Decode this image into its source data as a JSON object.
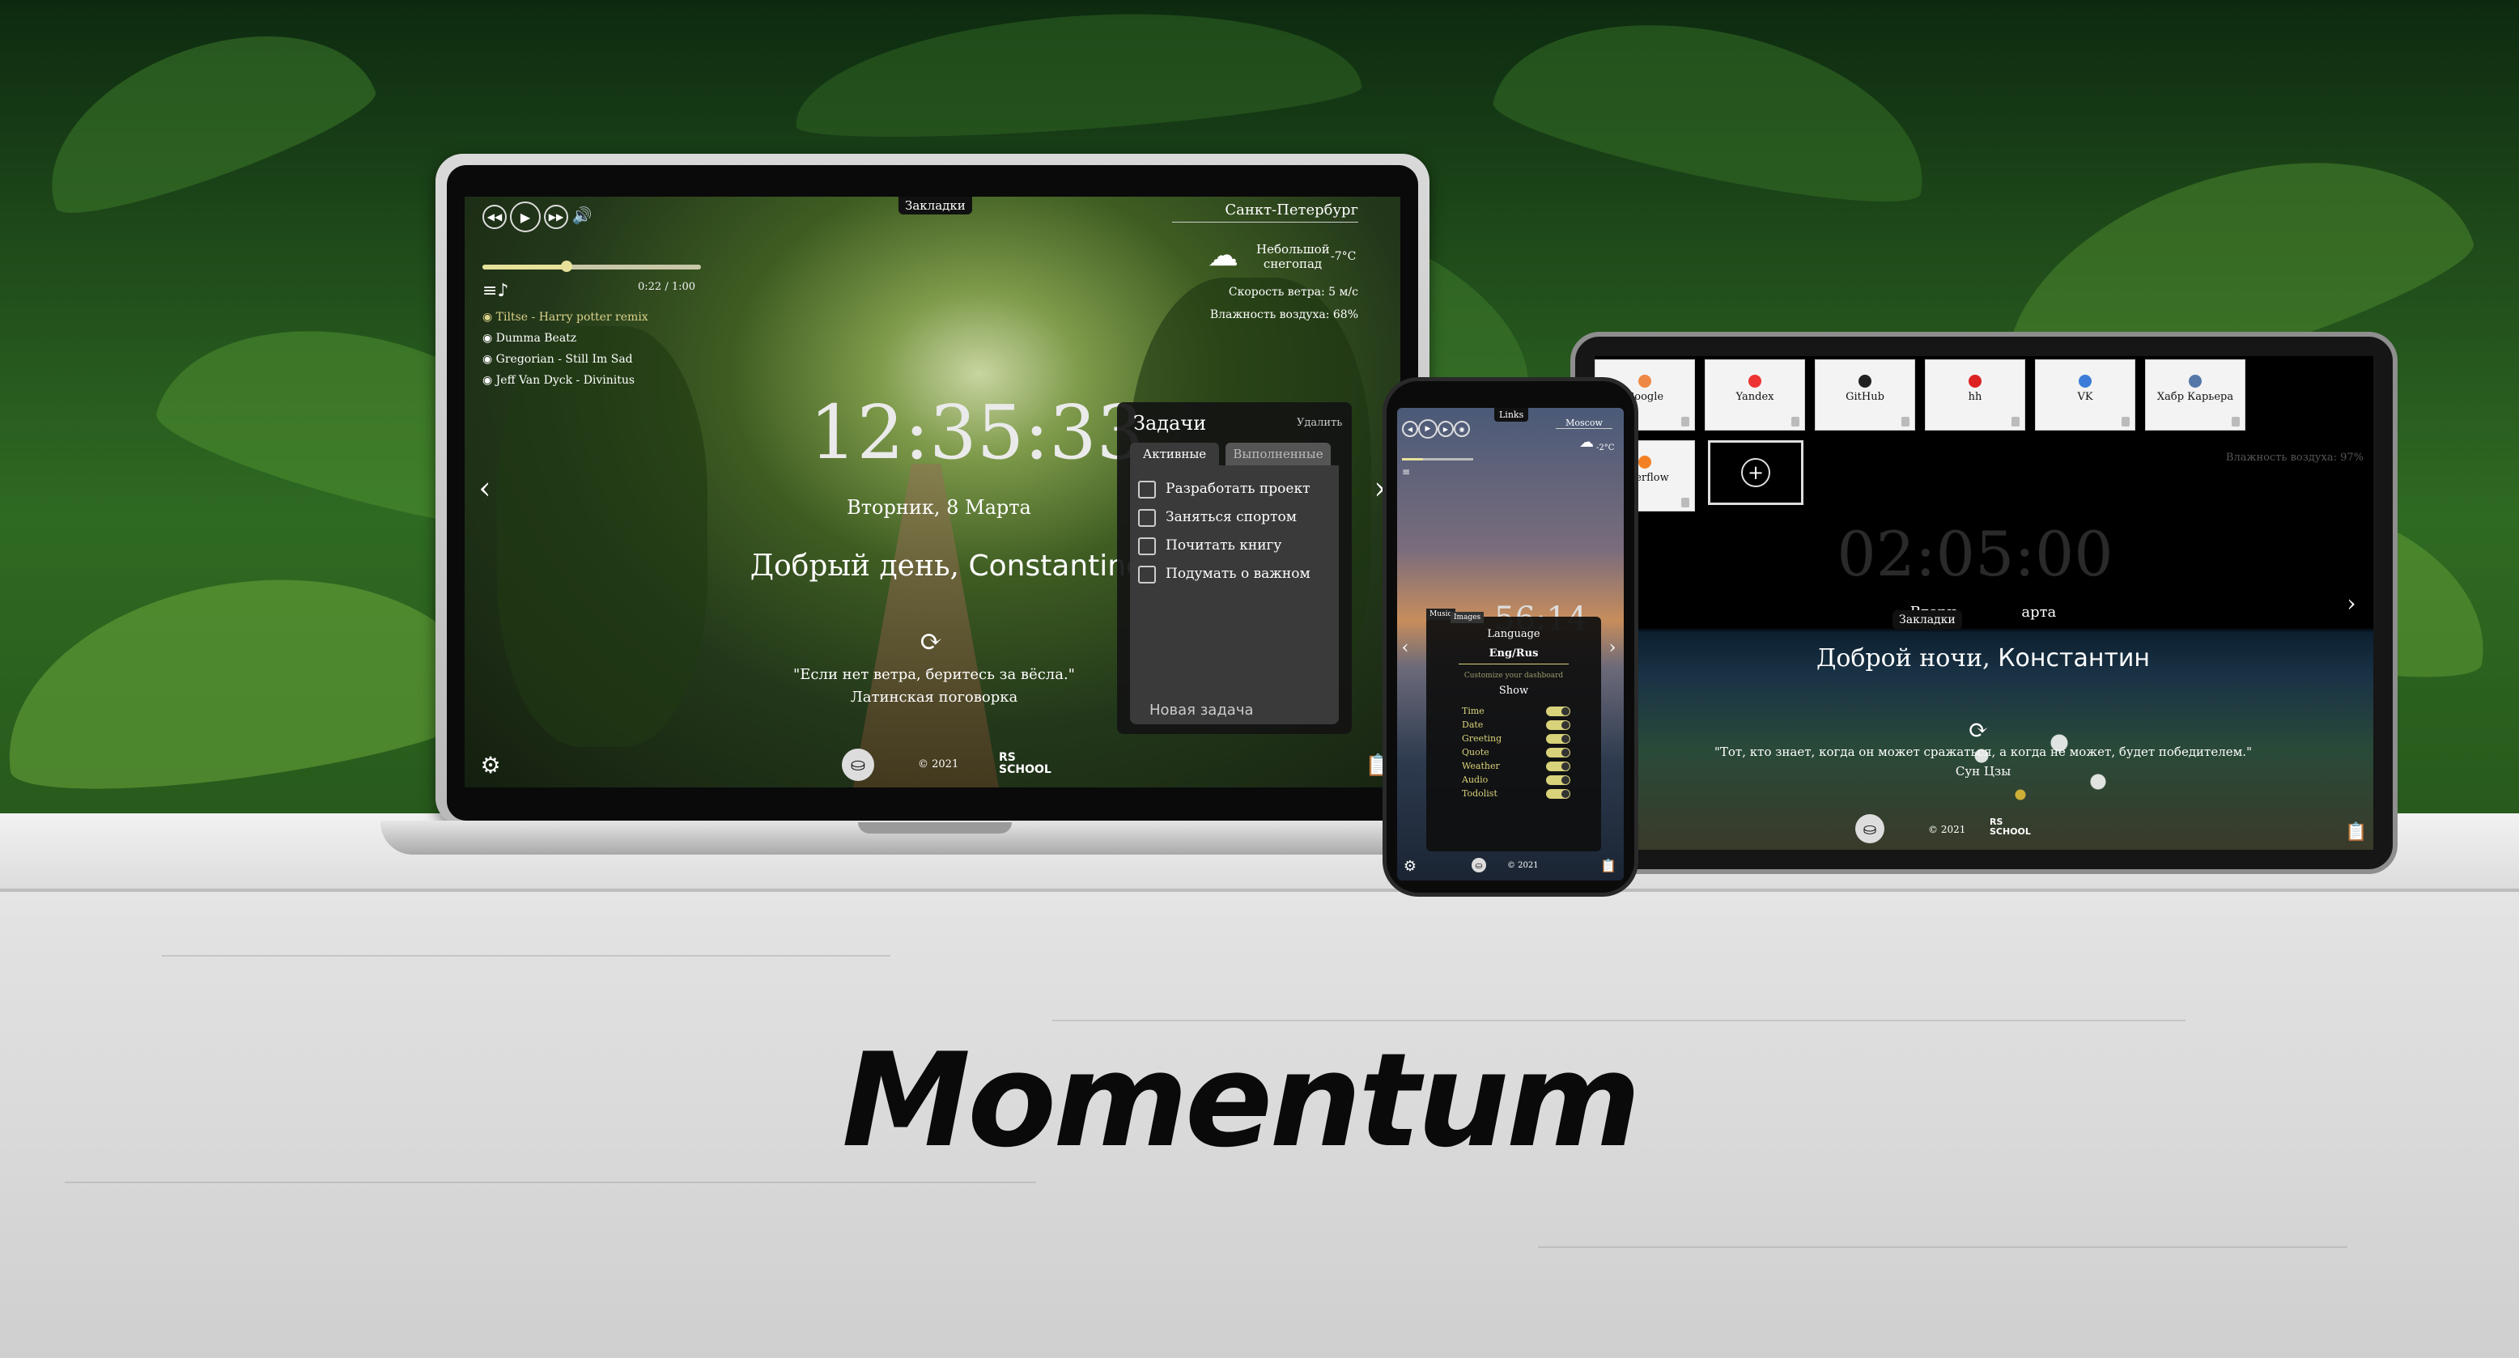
{
  "brand": {
    "logo_text": "Momentum"
  },
  "laptop": {
    "bookmarks_label": "Закладки",
    "player": {
      "time": "0:22 / 1:00",
      "playlist": [
        "Tiltse - Harry potter remix",
        "Dumma Beatz",
        "Gregorian - Still Im Sad",
        "Jeff Van Dyck - Divinitus"
      ]
    },
    "weather": {
      "city": "Санкт-Петербург",
      "description": "Небольшой снегопад",
      "temperature": "-7°C",
      "wind": "Скорость ветра: 5 м/с",
      "humidity": "Влажность воздуха: 68%"
    },
    "time": "12:35:33",
    "date": "Вторник, 8 Марта",
    "greeting": "Добрый день,",
    "name": "Constantine",
    "quote": "\"Если нет ветра, беритесь за вёсла.\"",
    "quote_author": "Латинская поговорка",
    "copyright": "© 2021",
    "school": "RS SCHOOL",
    "todo": {
      "title": "Задачи",
      "delete_label": "Удалить",
      "tab_active": "Активные",
      "tab_done": "Выполненные",
      "tasks": [
        "Разработать проект",
        "Заняться спортом",
        "Почитать книгу",
        "Подумать о важном"
      ],
      "new_task_placeholder": "Новая задача"
    }
  },
  "phone": {
    "links_label": "Links",
    "city": "Moscow",
    "temperature": "-2°C",
    "time_partial": "56:14",
    "settings": {
      "tab_music": "Music",
      "tab_images": "Images",
      "language_title": "Language",
      "language_value": "Eng/Rus",
      "subtitle": "Customize your dashboard",
      "show_title": "Show",
      "options": [
        "Time",
        "Date",
        "Greeting",
        "Quote",
        "Weather",
        "Audio",
        "Todolist"
      ]
    },
    "copyright": "© 2021"
  },
  "tablet": {
    "links": [
      "Google",
      "Yandex",
      "GitHub",
      "hh",
      "VK",
      "Хабр Карьера",
      "Overflow"
    ],
    "add_link": "+",
    "time": "02:05:00",
    "date": "Вторн",
    "date_tail": "арта",
    "bookmarks_label": "Закладки",
    "greeting": "Доброй ночи,",
    "name": "Константин",
    "quote": "\"Тот, кто знает, когда он может сражаться, а когда не может, будет победителем.\"",
    "quote_author": "Сун Цзы",
    "humidity": "Влажность воздуха: 97%",
    "copyright": "© 2021",
    "school": "RS SCHOOL"
  },
  "colors": {
    "accent_toggle": "#d8d27a",
    "logo": "#0a0a0a"
  }
}
